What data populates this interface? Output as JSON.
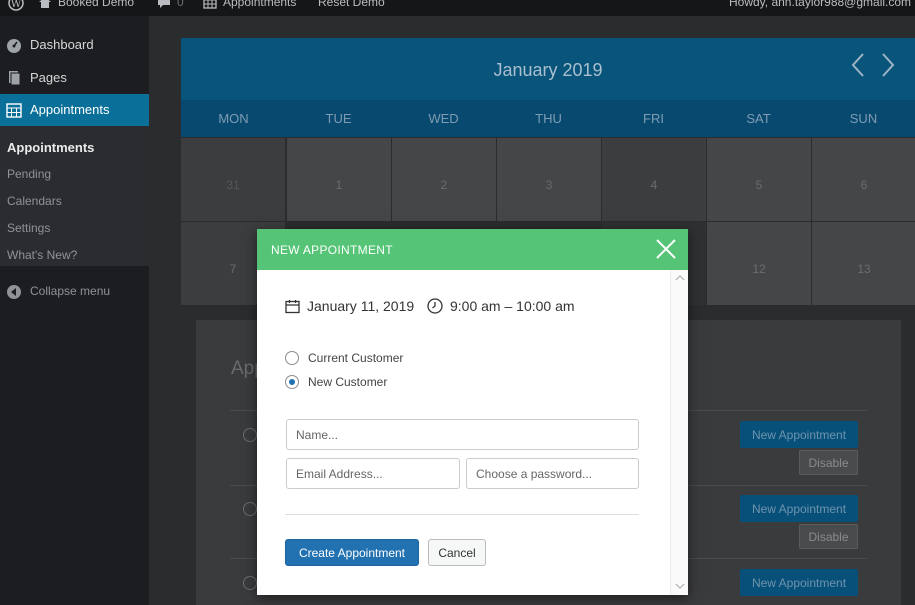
{
  "adminbar": {
    "site_name": "Booked Demo",
    "comments_count": "0",
    "appointments_label": "Appointments",
    "reset_label": "Reset Demo",
    "howdy": "Howdy, ann.taylor988@gmail.com"
  },
  "sidebar": {
    "items": [
      {
        "label": "Dashboard",
        "icon": "dashboard-icon"
      },
      {
        "label": "Pages",
        "icon": "pages-icon"
      },
      {
        "label": "Appointments",
        "icon": "calendar-icon"
      }
    ],
    "submenu": [
      "Appointments",
      "Pending",
      "Calendars",
      "Settings",
      "What's New?"
    ],
    "collapse_label": "Collapse menu"
  },
  "calendar": {
    "month_title": "January 2019",
    "day_names": [
      "MON",
      "TUE",
      "WED",
      "THU",
      "FRI",
      "SAT",
      "SUN"
    ],
    "week1": [
      "31",
      "1",
      "2",
      "3",
      "4",
      "5",
      "6"
    ],
    "week2": [
      "7",
      "12",
      "13"
    ]
  },
  "appointments_panel": {
    "title": "App",
    "new_appointment_label": "New Appointment",
    "disable_label": "Disable"
  },
  "modal": {
    "title": "NEW APPOINTMENT",
    "date": "January 11, 2019",
    "time": "9:00 am – 10:00 am",
    "customer_options": [
      {
        "label": "Current Customer",
        "checked": false
      },
      {
        "label": "New Customer",
        "checked": true
      }
    ],
    "name_placeholder": "Name...",
    "email_placeholder": "Email Address...",
    "password_placeholder": "Choose a password...",
    "create_label": "Create Appointment",
    "cancel_label": "Cancel"
  },
  "colors": {
    "accent_blue": "#2271b1",
    "modal_header_green": "#55c476",
    "calendar_header": "#09547a",
    "sidebar_active": "#0a6f99"
  }
}
